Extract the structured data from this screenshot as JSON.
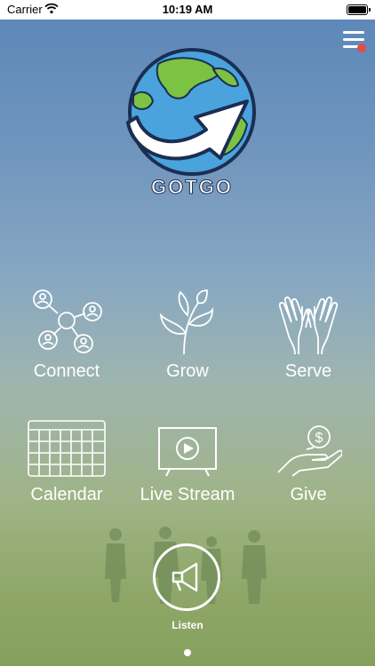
{
  "status_bar": {
    "carrier": "Carrier",
    "time": "10:19 AM"
  },
  "app": {
    "logo_text": "GOTGO"
  },
  "nav": {
    "connect": "Connect",
    "grow": "Grow",
    "serve": "Serve",
    "calendar": "Calendar",
    "live_stream": "Live Stream",
    "give": "Give"
  },
  "listen": {
    "label": "Listen"
  },
  "icons": {
    "menu": "hamburger-icon",
    "notification": "notification-dot",
    "connect": "network-people-icon",
    "grow": "leaves-icon",
    "serve": "open-hands-icon",
    "calendar": "calendar-grid-icon",
    "live_stream": "video-screen-icon",
    "give": "hand-coin-icon",
    "listen": "megaphone-icon"
  },
  "colors": {
    "notification": "#e54b4b",
    "text": "#ffffff"
  }
}
